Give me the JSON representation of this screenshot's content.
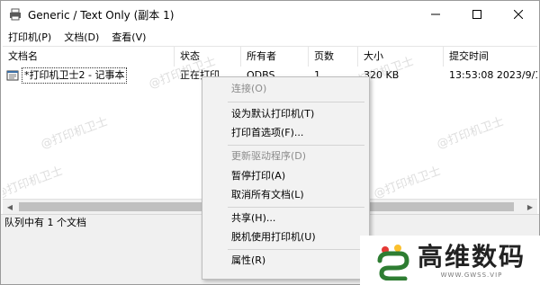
{
  "window": {
    "title": "Generic / Text Only (副本 1)"
  },
  "menubar": {
    "items": [
      {
        "label": "打印机(P)"
      },
      {
        "label": "文档(D)"
      },
      {
        "label": "查看(V)"
      }
    ]
  },
  "list": {
    "columns": [
      "文档名",
      "状态",
      "所有者",
      "页数",
      "大小",
      "提交时间"
    ],
    "rows": [
      {
        "doc": "*打印机卫士2 - 记事本",
        "status": "正在打印",
        "owner": "ODBS",
        "pages": "1",
        "size": "320 KB",
        "time": "13:53:08  2023/9/1"
      }
    ]
  },
  "statusbar": {
    "text": "队列中有 1 个文档"
  },
  "context_menu": {
    "items": [
      {
        "label": "连接(O)",
        "disabled": true
      },
      {
        "label": "设为默认打印机(T)",
        "disabled": false
      },
      {
        "label": "打印首选项(F)...",
        "disabled": false
      },
      {
        "label": "更新驱动程序(D)",
        "disabled": true
      },
      {
        "label": "暂停打印(A)",
        "disabled": false
      },
      {
        "label": "取消所有文档(L)",
        "disabled": false
      },
      {
        "label": "共享(H)...",
        "disabled": false
      },
      {
        "label": "脱机使用打印机(U)",
        "disabled": false
      },
      {
        "label": "属性(R)",
        "disabled": false
      }
    ]
  },
  "watermark": {
    "text": "@打印机卫士"
  },
  "logo": {
    "main": "高维数码",
    "sub": "WWW.GWSS.VIP"
  },
  "icons": [
    "printer-icon",
    "minimize-icon",
    "maximize-icon",
    "close-icon",
    "document-icon",
    "scroll-left-icon",
    "scroll-right-icon",
    "logo-mark-icon"
  ]
}
